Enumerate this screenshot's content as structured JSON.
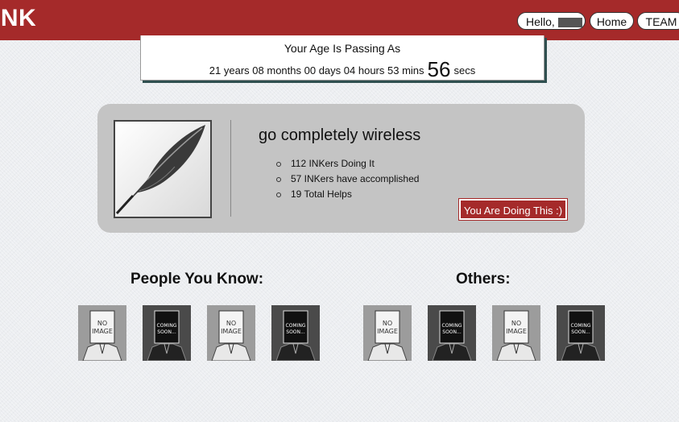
{
  "header": {
    "logo": "INK",
    "hello_label": "Hello,",
    "nav": {
      "home": "Home",
      "team": "TEAM"
    }
  },
  "age": {
    "title": "Your Age Is Passing As",
    "years": "21 years",
    "months": "08 months",
    "days": "00 days",
    "hours": "04 hours",
    "mins": "53 mins",
    "secs": "56",
    "secs_label": "secs"
  },
  "card": {
    "title": "go completely wireless",
    "stats": [
      "112 INKers Doing It",
      "57 INKers have accomplished",
      "19 Total Helps"
    ],
    "button": "You Are Doing This :)"
  },
  "sections": {
    "people": {
      "title": "People You Know:"
    },
    "others": {
      "title": "Others:"
    }
  },
  "avatars": {
    "people": [
      "no-image",
      "coming-soon",
      "no-image",
      "coming-soon"
    ],
    "others": [
      "no-image",
      "coming-soon",
      "no-image",
      "coming-soon"
    ]
  },
  "avatar_text": {
    "no_image": [
      "NO",
      "IMAGE"
    ],
    "coming_soon": [
      "COMING",
      "SOON..."
    ]
  },
  "colors": {
    "brand": "#a52a2a",
    "card": "#c4c4c4",
    "background": "#eceef1"
  }
}
